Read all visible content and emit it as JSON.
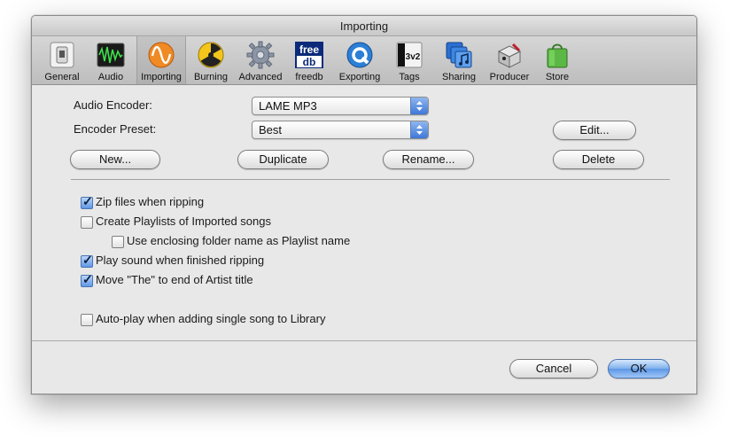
{
  "window": {
    "title": "Importing"
  },
  "toolbar": {
    "items": [
      {
        "label": "General",
        "icon": "general-switch-icon"
      },
      {
        "label": "Audio",
        "icon": "audio-waveform-icon"
      },
      {
        "label": "Importing",
        "icon": "importing-sine-icon",
        "selected": true
      },
      {
        "label": "Burning",
        "icon": "burning-radiation-icon"
      },
      {
        "label": "Advanced",
        "icon": "advanced-gear-icon"
      },
      {
        "label": "freedb",
        "icon": "freedb-logo-icon",
        "logo_text_1": "free",
        "logo_text_2": "db"
      },
      {
        "label": "Exporting",
        "icon": "exporting-quicktime-icon"
      },
      {
        "label": "Tags",
        "icon": "tags-id3v2-icon",
        "logo_text": "3v2"
      },
      {
        "label": "Sharing",
        "icon": "sharing-music-icon"
      },
      {
        "label": "Producer",
        "icon": "producer-box-icon"
      },
      {
        "label": "Store",
        "icon": "store-bag-icon"
      }
    ]
  },
  "encoder": {
    "audio_label": "Audio Encoder:",
    "audio_value": "LAME MP3",
    "preset_label": "Encoder Preset:",
    "preset_value": "Best",
    "edit_button": "Edit...",
    "new_button": "New...",
    "duplicate_button": "Duplicate",
    "rename_button": "Rename...",
    "delete_button": "Delete"
  },
  "options": {
    "zip": {
      "label": "Zip files when ripping",
      "checked": true
    },
    "create_playlists": {
      "label": "Create Playlists of Imported songs",
      "checked": false
    },
    "enclosing_folder": {
      "label": "Use enclosing folder name as Playlist name",
      "checked": false
    },
    "play_sound": {
      "label": "Play sound when finished ripping",
      "checked": true
    },
    "move_the": {
      "label": "Move \"The\" to end of Artist title",
      "checked": true
    },
    "autoplay": {
      "label": "Auto-play when adding single song to Library",
      "checked": false
    }
  },
  "footer": {
    "cancel_button": "Cancel",
    "ok_button": "OK"
  },
  "colors": {
    "accent": "#5d97e6",
    "window_bg": "#e8e8e8"
  }
}
